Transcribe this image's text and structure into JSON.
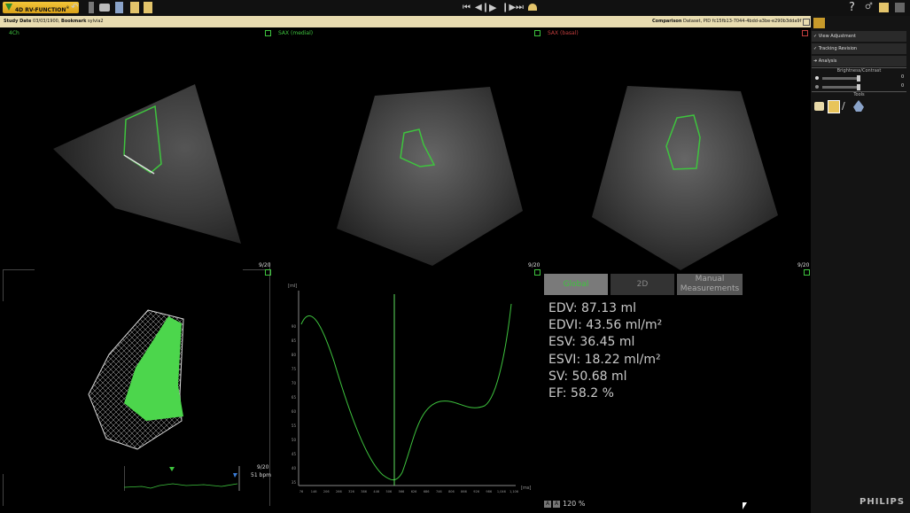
{
  "toolbar": {
    "app_name": "4D RV-FUNCTION",
    "app_sup": "®",
    "nav": {
      "first": "⏮",
      "prev": "◀❙",
      "play": "▶",
      "next": "❙▶",
      "last": "⏭"
    },
    "help": "?"
  },
  "info": {
    "study_date_label": "Study Date",
    "study_date": "03/03/1900",
    "bookmark_label": "Bookmark",
    "bookmark": "sylvia2",
    "comparison_label": "Comparison",
    "comparison_text": "Dataset, PID",
    "pid": "fc15fb13-7044-4bdd-a3be-e290b3dda9f"
  },
  "views": {
    "fourch": {
      "label": "4Ch",
      "frame": "9/20"
    },
    "sax_medial": {
      "label": "SAX (medial)",
      "frame": "9/20"
    },
    "sax_basal": {
      "label": "SAX (basal)",
      "frame": "9/20"
    },
    "model3d": {
      "frame": "9/20",
      "bpm": "51 bpm"
    }
  },
  "graph": {
    "ylabel": "[ml]",
    "xlabel": "[ms]",
    "yticks": [
      "90",
      "85",
      "80",
      "75",
      "70",
      "65",
      "60",
      "55",
      "50",
      "45",
      "40",
      "35"
    ],
    "xticks": [
      "76",
      "146",
      "206",
      "266",
      "326",
      "386",
      "446",
      "506",
      "566",
      "626",
      "686",
      "746",
      "806",
      "866",
      "926",
      "986",
      "1,046",
      "1,106"
    ]
  },
  "results": {
    "tabs": [
      "Global",
      "2D",
      "Manual Measurements"
    ],
    "items": [
      "EDV: 87.13 ml",
      "EDVI: 43.56 ml/m²",
      "ESV: 36.45 ml",
      "ESVI: 18.22 ml/m²",
      "SV: 50.68 ml",
      "EF: 58.2 %"
    ],
    "zoom": "120 %",
    "zoom_minus": "A",
    "zoom_plus": "A"
  },
  "panel": {
    "view_adjustment": "View Adjustment",
    "tracking_revision": "Tracking Revision",
    "analysis": "Analysis",
    "brightness_contrast": "Brightness/Contrast",
    "brightness_value": "0",
    "contrast_value": "0",
    "tools": "Tools"
  },
  "brand": "PHILIPS",
  "colors": {
    "accent": "#f3c63a",
    "contour": "#3ec43e",
    "basal": "#c43e3e",
    "info_bg": "#e8dcb0"
  }
}
